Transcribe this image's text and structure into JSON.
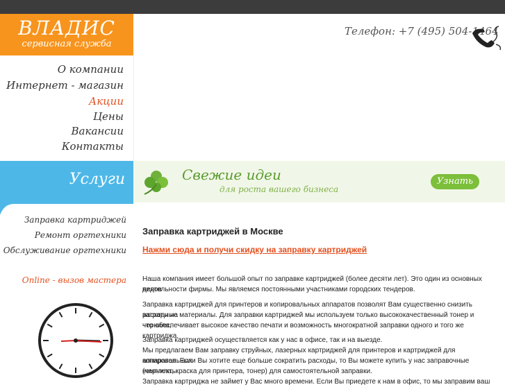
{
  "header": {
    "logo_title": "ВЛАДИС",
    "logo_subtitle": "сервисная служба",
    "phone": "Телефон:  +7 (495) 504-1464"
  },
  "main_nav": {
    "items": [
      {
        "label": "О компании"
      },
      {
        "label": "Интернет - магазин"
      },
      {
        "label": "Акции"
      },
      {
        "label": "Цены"
      },
      {
        "label": "Вакансии"
      },
      {
        "label": "Контакты"
      }
    ],
    "active": "Акции"
  },
  "services": {
    "label": "Услуги",
    "items": [
      {
        "label": "Заправка картриджей"
      },
      {
        "label": "Ремонт оргтехники"
      },
      {
        "label": "Обслуживание оргтехники"
      }
    ],
    "online": "Online - вызов мастера"
  },
  "banner": {
    "title": "Свежие идеи",
    "subtitle": "для роста вашего бизнеса",
    "button": "Узнать"
  },
  "content": {
    "heading": "Заправка картриджей в Москве",
    "promo_link": "Нажми сюда и получи скидку на заправку картриджей",
    "lines": [
      "Наша компания имеет большой опыт по заправке картриджей (более десяти лет). Это один из основных видов",
      "деятельности фирмы. Мы являемся постоянными участниками городских тендеров.",
      "Заправка картриджей для принтеров и копировальных аппаратов позволят Вам существенно снизить затраты на",
      "расходные материалы. Для заправки картриджей мы используем только высококачественный тонер и чернила,",
      "что обеспечивает высокое качество печати и возможность многократной заправки одного и того же картриджа.",
      "Заправка картриджей осуществляется как у нас в офисе, так и на выезде.",
      "Мы предлагаем Вам заправку струйных, лазерных картриджей для принтеров и картриджей для копировальных",
      "аппаратов. Если Вы хотите еще больше сократить расходы, то Вы можете купить у нас заправочные комплекты",
      "(чернила, краска для принтера, тонер) для самостоятельной заправки.",
      "Заправка картриджа не займет у Вас много времени. Если Вы приедете к нам в офис, то мы заправим ваш"
    ]
  },
  "colors": {
    "orange": "#f7941d",
    "blue": "#4db8e8",
    "accent": "#e3501f",
    "green": "#7cbf3b",
    "dark_bar": "#3c3c3c"
  },
  "icons": [
    "phone-icon",
    "clover-icon",
    "clock-icon"
  ]
}
